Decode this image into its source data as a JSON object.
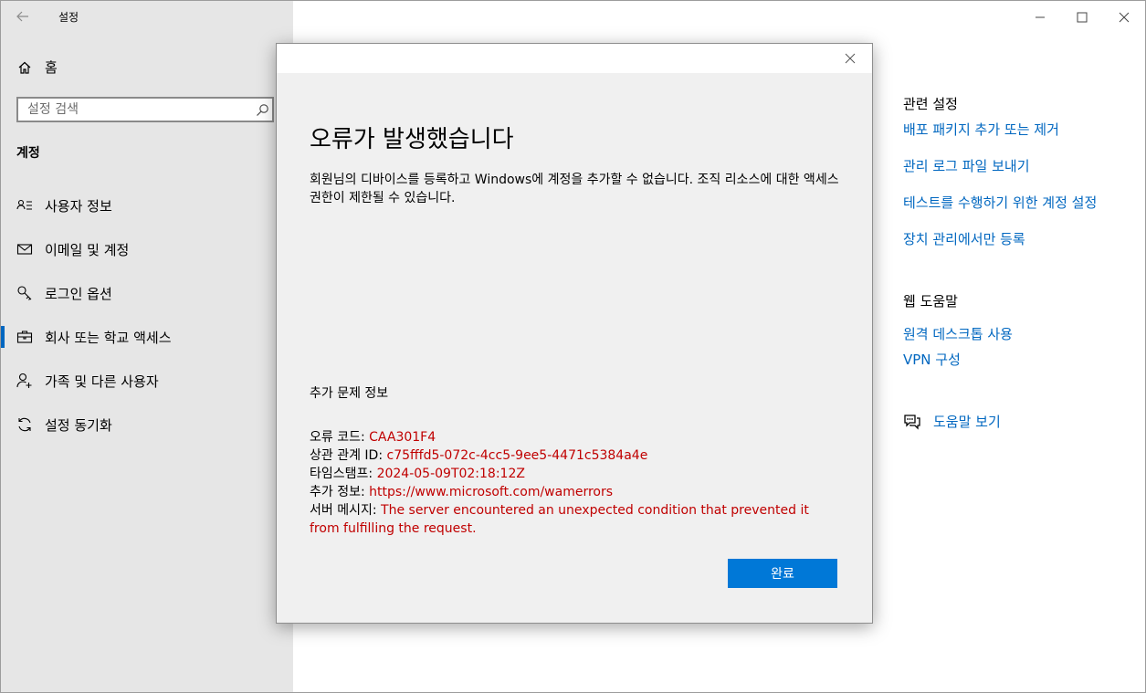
{
  "window": {
    "title": "설정"
  },
  "sidebar": {
    "home_label": "홈",
    "search_placeholder": "설정 검색",
    "section_title": "계정",
    "items": [
      {
        "label": "사용자 정보",
        "icon": "user-info-icon"
      },
      {
        "label": "이메일 및 계정",
        "icon": "mail-icon"
      },
      {
        "label": "로그인 옵션",
        "icon": "key-icon"
      },
      {
        "label": "회사 또는 학교 액세스",
        "icon": "briefcase-icon",
        "active": true
      },
      {
        "label": "가족 및 다른 사용자",
        "icon": "add-person-icon"
      },
      {
        "label": "설정 동기화",
        "icon": "sync-icon"
      }
    ]
  },
  "right_panel": {
    "related_title": "관련 설정",
    "related_links": [
      "배포 패키지 추가 또는 제거",
      "관리 로그 파일 보내기",
      "테스트를 수행하기 위한 계정 설정",
      "장치 관리에서만 등록"
    ],
    "web_help_title": "웹 도움말",
    "web_help_links": [
      "원격 데스크톱 사용",
      "VPN 구성"
    ],
    "help_link": "도움말 보기"
  },
  "dialog": {
    "title": "오류가 발생했습니다",
    "message": "회원님의 디바이스를 등록하고 Windows에 계정을 추가할 수 없습니다. 조직 리소스에 대한 액세스 권한이 제한될 수 있습니다.",
    "more_info_title": "추가 문제 정보",
    "details": {
      "error_code_label": "오류 코드: ",
      "error_code": "CAA301F4",
      "correlation_label": "상관 관계 ID: ",
      "correlation_id": "c75fffd5-072c-4cc5-9ee5-4471c5384a4e",
      "timestamp_label": "타임스탬프: ",
      "timestamp": "2024-05-09T02:18:12Z",
      "more_info_label": "추가 정보: ",
      "more_info_url": "https://www.microsoft.com/wamerrors",
      "server_msg_label": "서버 메시지: ",
      "server_msg": "The server encountered an unexpected condition that prevented it from fulfilling the request."
    },
    "done_label": "완료"
  },
  "colors": {
    "accent": "#0067c0",
    "button": "#0078d7",
    "error": "#c00000",
    "sidebar_bg": "#e6e6e6",
    "dialog_bg": "#f0f0f0"
  }
}
